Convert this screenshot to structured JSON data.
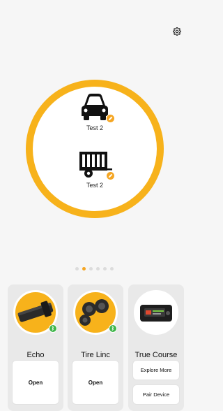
{
  "colors": {
    "accent": "#f7b21b",
    "badge": "#f5a623",
    "status_green": "#3fb54a",
    "background": "#f6f6f6",
    "card": "#e9e9e9"
  },
  "header": {
    "settings_icon": "gear-icon"
  },
  "hub": {
    "vehicles": [
      {
        "name": "Test 2",
        "icon": "car-icon",
        "badge_icon": "edit-pencil-icon"
      },
      {
        "name": "Test 2",
        "icon": "trailer-icon",
        "badge_icon": "edit-pencil-icon"
      }
    ]
  },
  "pager": {
    "count": 6,
    "active_index": 1
  },
  "products": [
    {
      "name": "Echo",
      "image": "echo-device-image",
      "connected_icon": "bluetooth-icon",
      "buttons": [
        "Open"
      ]
    },
    {
      "name": "Tire Linc",
      "image": "tire-sensors-image",
      "connected_icon": "bluetooth-icon",
      "buttons": [
        "Open"
      ]
    },
    {
      "name": "True Course",
      "image": "true-course-device-image",
      "buttons": [
        "Explore More",
        "Pair Device"
      ]
    }
  ]
}
